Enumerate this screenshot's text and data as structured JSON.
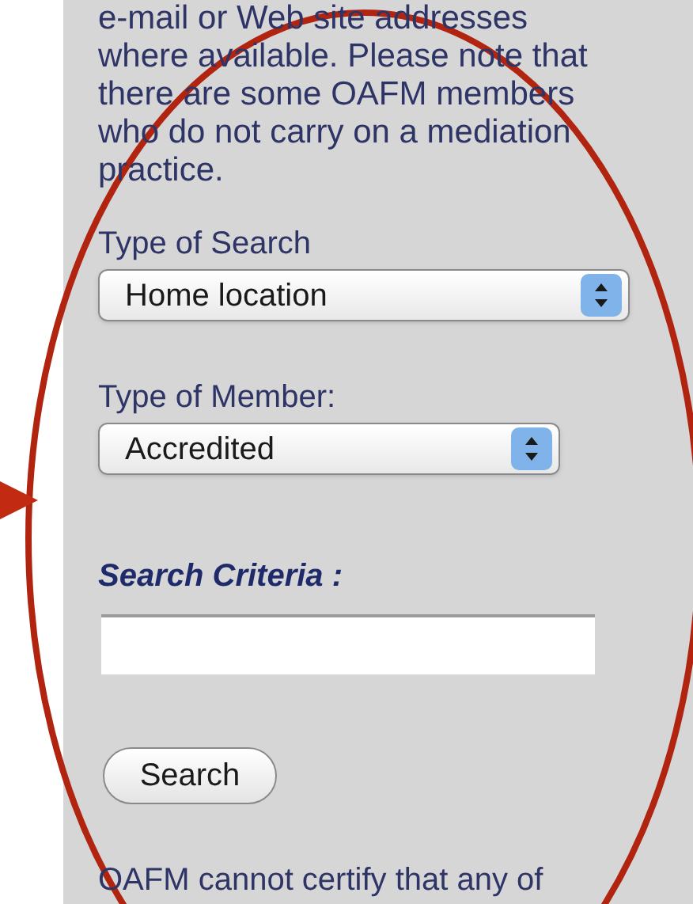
{
  "intro_lines": [
    "e-mail or Web site addresses",
    "where available. Please note that",
    "there are some OAFM members",
    "who do not carry on a mediation",
    "practice."
  ],
  "fields": [
    {
      "kind": "select",
      "label": "Type of Search",
      "value": "Home location"
    },
    {
      "kind": "select",
      "label": "Type of Member:",
      "value": "Accredited"
    },
    {
      "kind": "text",
      "label": "Search Criteria :"
    }
  ],
  "button": "Search",
  "footer": "OAFM cannot certify that any of"
}
